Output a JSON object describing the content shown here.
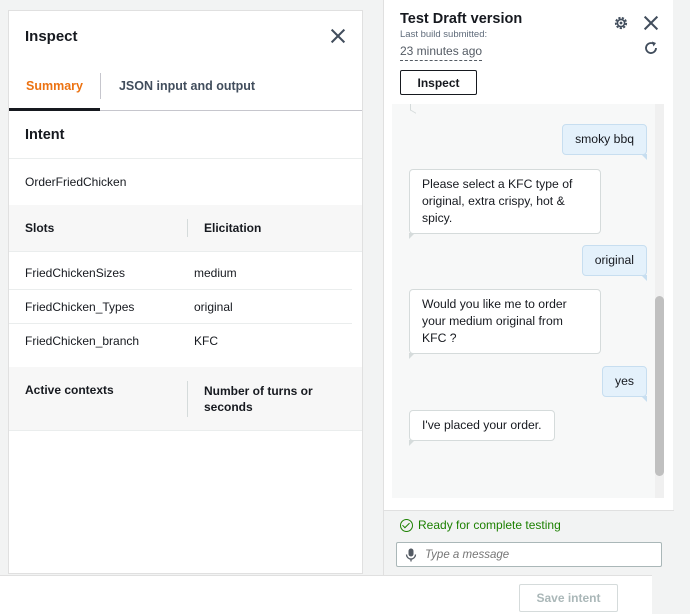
{
  "inspect": {
    "title": "Inspect",
    "tabs": [
      {
        "label": "Summary",
        "active": true
      },
      {
        "label": "JSON input and output",
        "active": false
      }
    ],
    "intent_heading": "Intent",
    "intent_value": "OrderFriedChicken",
    "slots_table": {
      "headers": [
        "Slots",
        "Elicitation"
      ],
      "rows": [
        {
          "slot": "FriedChickenSizes",
          "value": "medium"
        },
        {
          "slot": "FriedChicken_Types",
          "value": "original"
        },
        {
          "slot": "FriedChicken_branch",
          "value": "KFC"
        }
      ]
    },
    "contexts_table": {
      "headers": [
        "Active contexts",
        "Number of turns or seconds"
      ]
    }
  },
  "test_panel": {
    "title": "Test Draft version",
    "last_build_label": "Last build submitted:",
    "last_build_time": "23 minutes ago",
    "inspect_button": "Inspect",
    "messages": [
      {
        "from": "user",
        "text": "smoky bbq"
      },
      {
        "from": "bot",
        "text": "Please select a KFC type of original, extra crispy, hot & spicy."
      },
      {
        "from": "user",
        "text": "original"
      },
      {
        "from": "bot",
        "text": "Would you like me to order your medium original from KFC ?"
      },
      {
        "from": "user",
        "text": "yes"
      },
      {
        "from": "bot",
        "text": "I've placed your order."
      }
    ],
    "status": "Ready for complete testing",
    "status_color": "#1d8102",
    "input_placeholder": "Type a message"
  },
  "footer": {
    "save_button": "Save intent"
  },
  "colors": {
    "accent_tab": "#ec7211",
    "user_bubble": "#e4f1fb"
  },
  "icons": [
    "close-icon",
    "gear-icon",
    "refresh-icon",
    "check-circle-icon",
    "microphone-icon"
  ]
}
